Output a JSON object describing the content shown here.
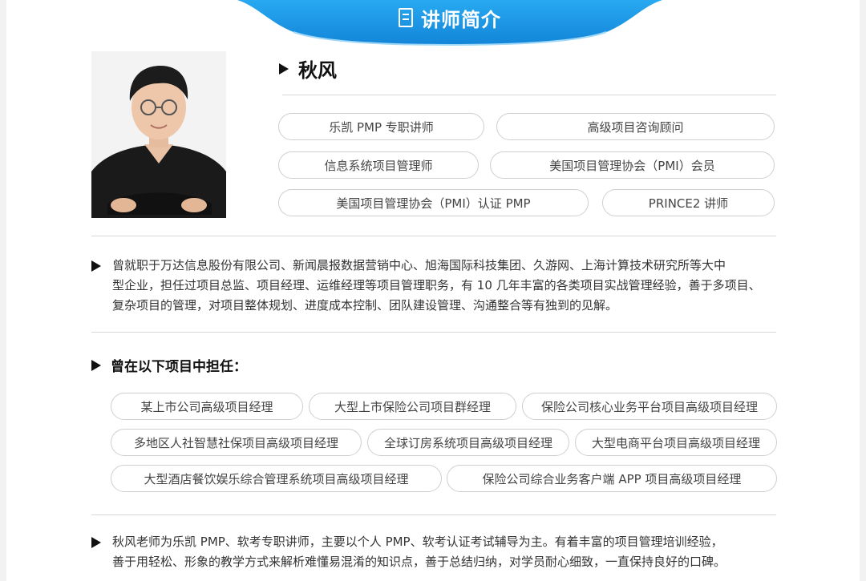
{
  "banner": {
    "title": "讲师简介",
    "icon": "document-icon",
    "color": "#1e9be8"
  },
  "instructor": {
    "name": "秋风",
    "tags": [
      "乐凯 PMP 专职讲师",
      "高级项目咨询顾问",
      "信息系统项目管理师",
      "美国项目管理协会（PMI）会员",
      "美国项目管理协会（PMI）认证 PMP",
      "PRINCE2 讲师"
    ]
  },
  "bio": {
    "lines": [
      "曾就职于万达信息股份有限公司、新闻晨报数据营销中心、旭海国际科技集团、久游网、上海计算技术研究所等大中",
      "型企业，担任过项目总监、项目经理、运维经理等项目管理职务，有 10 几年丰富的各类项目实战管理经验，善于多项目、",
      "复杂项目的管理，对项目整体规划、进度成本控制、团队建设管理、沟通整合等有独到的见解。"
    ]
  },
  "projects": {
    "title": "曾在以下项目中担任：",
    "items": [
      "某上市公司高级项目经理",
      "大型上市保险公司项目群经理",
      "保险公司核心业务平台项目高级项目经理",
      "多地区人社智慧社保项目高级项目经理",
      "全球订房系统项目高级项目经理",
      "大型电商平台项目高级项目经理",
      "大型酒店餐饮娱乐综合管理系统项目高级项目经理",
      "保险公司综合业务客户端 APP 项目高级项目经理"
    ]
  },
  "summary": {
    "lines": [
      "秋风老师为乐凯 PMP、软考专职讲师，主要以个人 PMP、软考认证考试辅导为主。有着丰富的项目管理培训经验，",
      "善于用轻松、形象的教学方式来解析难懂易混淆的知识点，善于总结归纳，对学员耐心细致，一直保持良好的口碑。"
    ]
  }
}
